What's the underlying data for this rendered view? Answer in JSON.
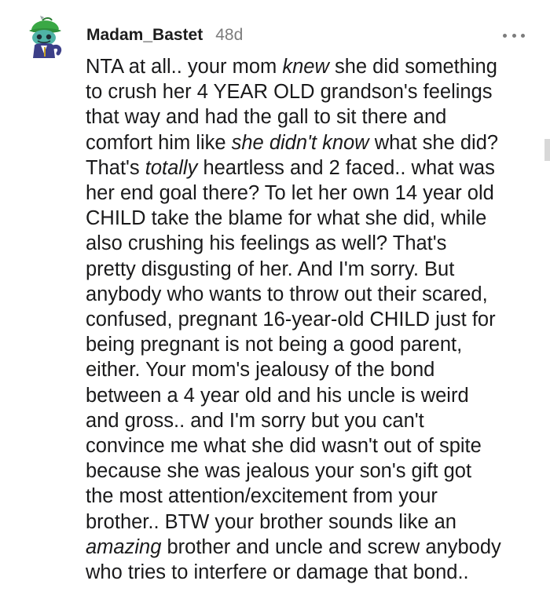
{
  "comment": {
    "username": "Madam_Bastet",
    "age": "48d",
    "avatar_icon": "snoo-avatar-icon",
    "more_icon": "more-options-icon",
    "lines": [
      [
        {
          "t": "NTA at all.. your mom "
        },
        {
          "t": "knew",
          "i": true
        },
        {
          "t": " she did something"
        }
      ],
      [
        {
          "t": "to crush her 4 YEAR OLD grandson's feelings"
        }
      ],
      [
        {
          "t": "that way and had the gall to sit there and"
        }
      ],
      [
        {
          "t": "comfort him like "
        },
        {
          "t": "she didn't know",
          "i": true
        },
        {
          "t": " what she did?"
        }
      ],
      [
        {
          "t": "That's "
        },
        {
          "t": "totally",
          "i": true
        },
        {
          "t": " heartless and 2 faced.. what was"
        }
      ],
      [
        {
          "t": "her end goal there? To let her own 14 year old"
        }
      ],
      [
        {
          "t": "CHILD take the blame for what she did, while"
        }
      ],
      [
        {
          "t": "also crushing his feelings as well? That's"
        }
      ],
      [
        {
          "t": "pretty disgusting of her. And I'm sorry. But"
        }
      ],
      [
        {
          "t": "anybody who wants to throw out their scared,"
        }
      ],
      [
        {
          "t": "confused, pregnant 16-year-old CHILD just for"
        }
      ],
      [
        {
          "t": "being pregnant is not being a good parent,"
        }
      ],
      [
        {
          "t": "either. Your mom's jealousy of the bond"
        }
      ],
      [
        {
          "t": "between a 4 year old and his uncle is weird"
        }
      ],
      [
        {
          "t": "and gross.. and I'm sorry but you can't"
        }
      ],
      [
        {
          "t": "convince me what she did wasn't out of spite"
        }
      ],
      [
        {
          "t": "because she was jealous your son's gift got"
        }
      ],
      [
        {
          "t": "the most attention/excitement from your"
        }
      ],
      [
        {
          "t": "brother.. BTW your brother sounds like an"
        }
      ],
      [
        {
          "t": "amazing",
          "i": true
        },
        {
          "t": " brother and uncle and screw anybody"
        }
      ],
      [
        {
          "t": "who tries to interfere or damage that bond.."
        }
      ]
    ]
  }
}
